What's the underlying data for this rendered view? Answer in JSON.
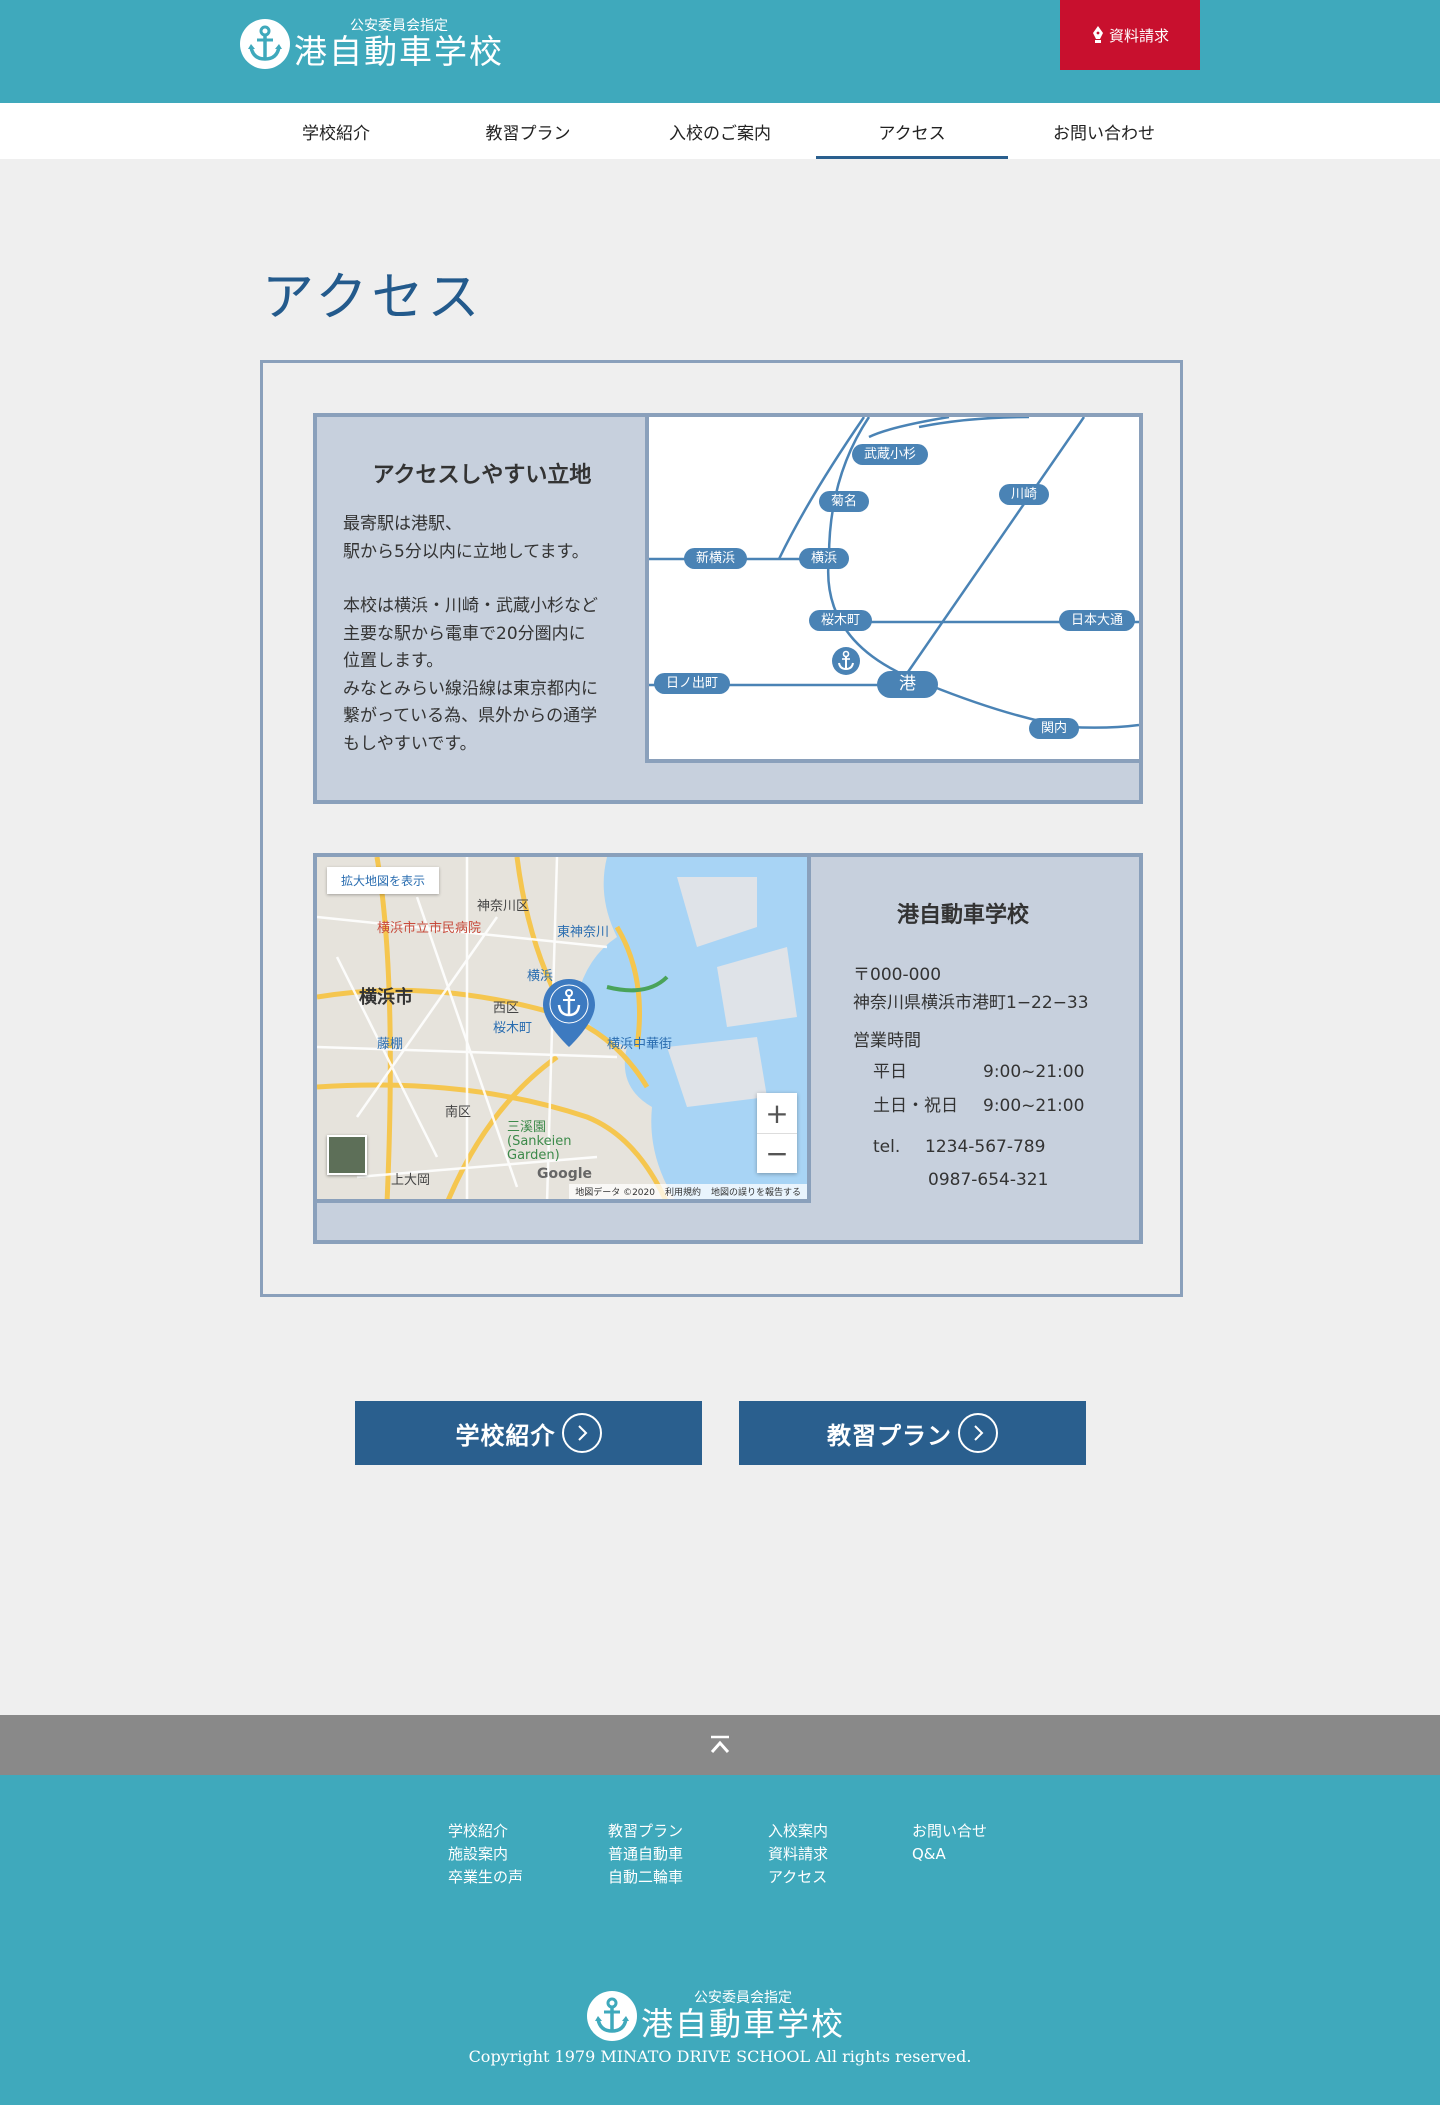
{
  "header": {
    "logo_small": "公安委員会指定",
    "logo_big": "港自動車学校",
    "request_label": "資料請求"
  },
  "nav": {
    "items": [
      {
        "label": "学校紹介"
      },
      {
        "label": "教習プラン"
      },
      {
        "label": "入校のご案内"
      },
      {
        "label": "アクセス"
      },
      {
        "label": "お問い合わせ"
      }
    ],
    "active": "アクセス"
  },
  "page_title": "アクセス",
  "access_card": {
    "heading": "アクセスしやすい立地",
    "lines1": [
      "最寄駅は港駅、",
      "駅から5分以内に立地してます。"
    ],
    "lines2": [
      "本校は横浜・川崎・武蔵小杉など",
      "主要な駅から電車で20分圏内に",
      "位置します。",
      "みなとみらい線沿線は東京都内に",
      "繋がっている為、県外からの通学",
      "もしやすいです。"
    ]
  },
  "route_map": {
    "stations": {
      "musashikosugi": "武蔵小杉",
      "kikuna": "菊名",
      "shinyokohama": "新横浜",
      "yokohama": "横浜",
      "kawasaki": "川崎",
      "sakuragicho": "桜木町",
      "nihonodori": "日本大通",
      "hinodecho": "日ノ出町",
      "minato": "港",
      "kannai": "関内"
    }
  },
  "google_map": {
    "expand_label": "拡大地図を表示",
    "labels": {
      "kanagawa_ku": "神奈川区",
      "shimin_hospital": "横浜市立市民病院",
      "higashi_kanagawa": "東神奈川",
      "yokohama_st": "横浜",
      "yokohama_shi": "横浜市",
      "nishi_ku": "西区",
      "sakuragicho": "桜木町",
      "chukagai": "横浜中華街",
      "fujigaoka": "藤棚",
      "minami_ku": "南区",
      "sankeien": "三溪園 (Sankeien Garden)",
      "kamiooka": "上大岡",
      "google": "Google"
    },
    "zoom_in": "+",
    "zoom_out": "−",
    "attribution": [
      "地図データ ©2020",
      "利用規約",
      "地図の誤りを報告する"
    ]
  },
  "school_info": {
    "name": "港自動車学校",
    "postal": "〒000-000",
    "address": "神奈川県横浜市港町1−22−33",
    "hours_label": "営業時間",
    "weekday_label": "平日",
    "weekday_hours": "9:00~21:00",
    "weekend_label": "土日・祝日",
    "weekend_hours": "9:00~21:00",
    "tel_label": "tel.",
    "tel1": "1234-567-789",
    "tel2": "0987-654-321"
  },
  "buttons": {
    "school_intro": "学校紹介",
    "plan": "教習プラン"
  },
  "footer": {
    "col1": [
      "学校紹介",
      "施設案内",
      "卒業生の声"
    ],
    "col2": [
      "教習プラン",
      "普通自動車",
      "自動二輪車"
    ],
    "col3": [
      "入校案内",
      "資料請求",
      "アクセス"
    ],
    "col4": [
      "お問い合せ",
      "Q&A"
    ],
    "logo_small": "公安委員会指定",
    "logo_big": "港自動車学校",
    "copyright": "Copyright 1979 MINATO DRIVE SCHOOL All rights reserved."
  },
  "colors": {
    "teal": "#3fa9bc",
    "navy": "#2a5f8e",
    "red": "#c8102e",
    "card_bg": "#c7d0dd",
    "card_border": "#8aa0bb"
  }
}
